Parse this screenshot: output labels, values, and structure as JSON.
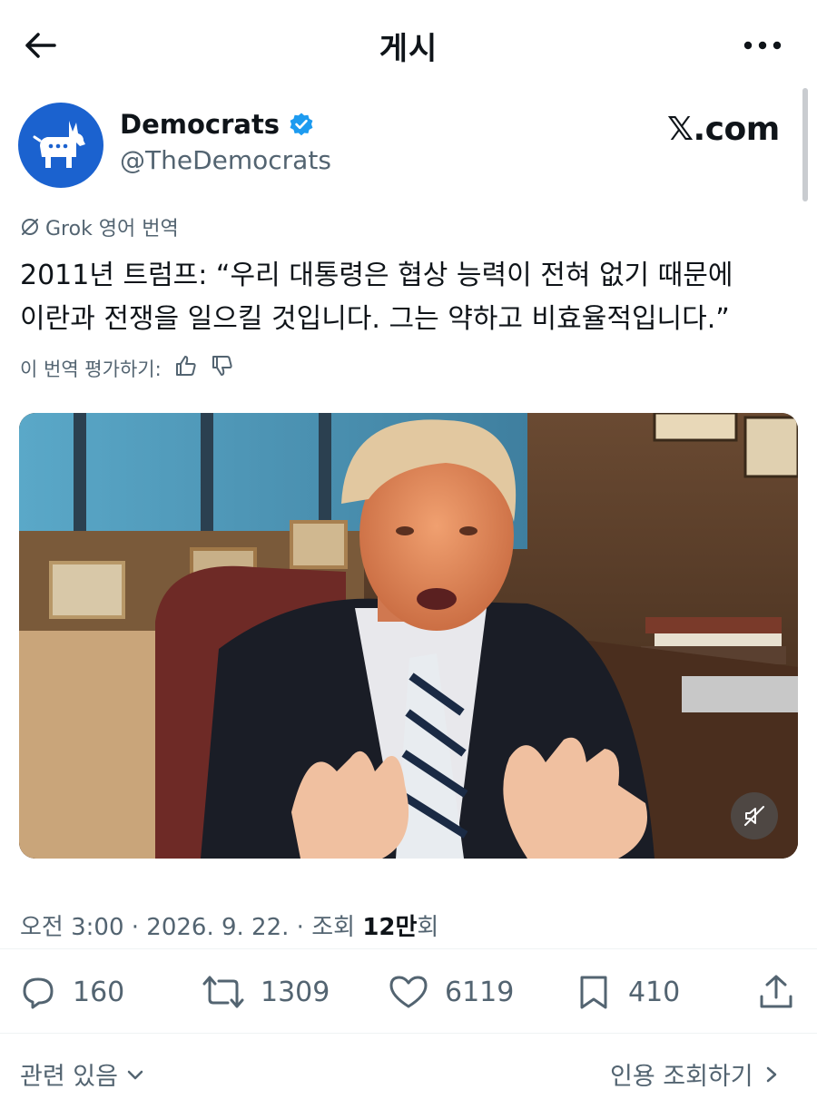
{
  "header": {
    "title": "게시"
  },
  "author": {
    "name": "Democrats",
    "handle": "@TheDemocrats",
    "site": "𝕏.com"
  },
  "translation": {
    "label": "Grok 영어 번역",
    "lines": [
      "2011년 트럼프: “우리 대통령은 협상 능력이 전혀 없기 때문에",
      "이란과 전쟁을 일으킬 것입니다. 그는 약하고 비효율적입니다.”"
    ],
    "rate_label": "이 번역 평가하기:"
  },
  "meta": {
    "time_date": "오전 3:00 · 2026. 9. 22. · 조회 ",
    "views": "12만",
    "views_suffix": "회"
  },
  "actions": {
    "replies": "160",
    "reposts": "1309",
    "likes": "6119",
    "bookmarks": "410"
  },
  "footer": {
    "related": "관련 있음",
    "quotes": "인용 조회하기"
  },
  "colors": {
    "verified": "#1d9bf0",
    "avatar_bg": "#1b62cf",
    "secondary_text": "#536471"
  }
}
